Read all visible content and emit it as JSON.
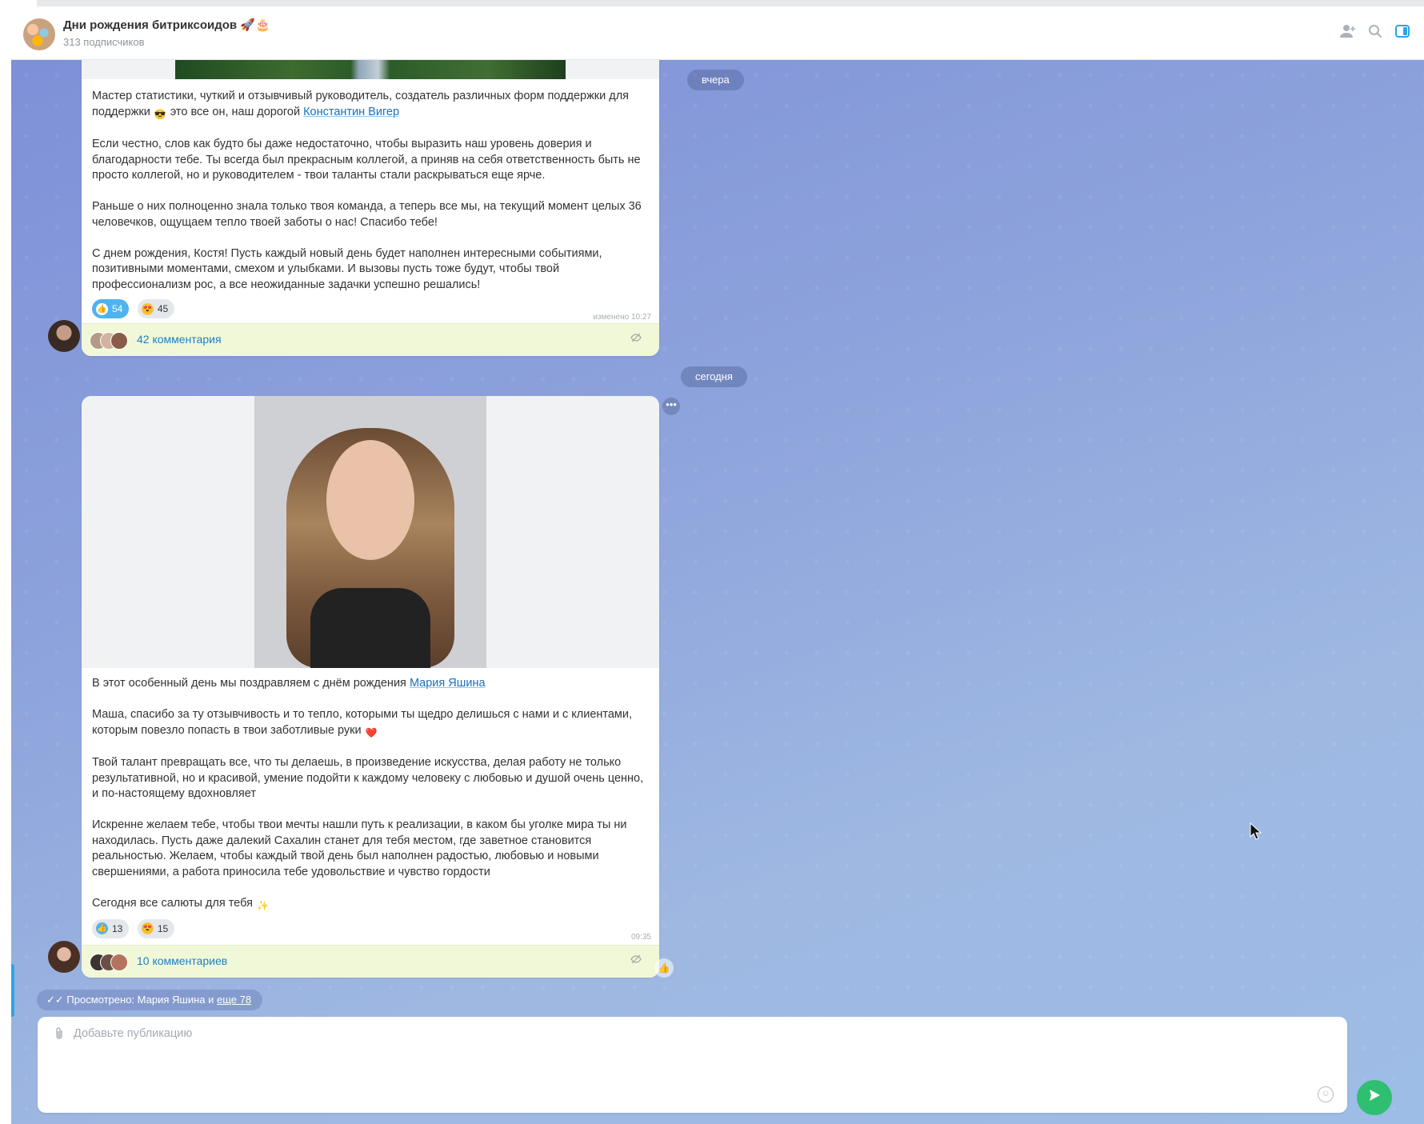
{
  "header": {
    "title": "Дни рождения битриксоидов 🚀🎂",
    "subscribers": "313 подписчиков",
    "icons": [
      "add-user-icon",
      "search-icon",
      "sidebar-toggle-icon"
    ]
  },
  "date_yesterday": "вчера",
  "date_today": "сегодня",
  "post1": {
    "p1_text": "Мастер статистики, чуткий и отзывчивый руководитель, создатель различных форм поддержки для поддержки ",
    "p1_emoji": "😎",
    "p1_after": " это все он, наш дорогой ",
    "p1_link": "Константин Вигер",
    "p2": "Если честно, слов как будто бы даже недостаточно, чтобы выразить наш уровень доверия и благодарности тебе. Ты всегда был прекрасным коллегой, а приняв на себя ответственность быть не просто коллегой, но и руководителем - твои таланты стали раскрываться еще ярче.",
    "p3": "Раньше о них полноценно знала только твоя команда, а теперь все мы, на текущий момент целых 36 человечков, ощущаем тепло твоей заботы о нас! Спасибо тебе!",
    "p4": "С днем рождения, Костя! Пусть каждый новый день будет наполнен интересными событиями, позитивными моментами, смехом и улыбками. И вызовы пусть тоже будут, чтобы твой профессионализм рос, а все неожиданные задачки успешно решались!",
    "like_count": "54",
    "face_count": "45",
    "timestamp": "изменено 10:27",
    "comments": "42 комментария"
  },
  "post2": {
    "p1_text": "В этот особенный день мы поздравляем с днём рождения ",
    "p1_link": "Мария Яшина",
    "p2_text": "Маша, спасибо за ту отзывчивость и то тепло, которыми ты щедро делишься с нами и с клиентами, которым повезло попасть в твои заботливые руки ",
    "p2_emoji": "❤️",
    "p3": "Твой талант превращать все, что ты делаешь, в произведение искусства, делая работу не только результативной, но и красивой, умение подойти к каждому человеку с любовью и душой очень ценно, и по-настоящему вдохновляет",
    "p4": "Искренне желаем тебе, чтобы твои мечты нашли путь к реализации, в каком бы уголке мира ты ни находилась. Пусть даже далекий Сахалин станет для тебя местом, где заветное становится реальностью. Желаем, чтобы каждый твой день был наполнен радостью, любовью и новыми свершениями, а работа приносила тебе удовольствие и чувство гордости",
    "p5_text": "Сегодня все салюты для тебя ",
    "p5_emoji": "✨",
    "like_count": "13",
    "face_count": "15",
    "timestamp": "09:35",
    "comments": "10 комментариев"
  },
  "seen": {
    "prefix": "Просмотрено: Мария Яшина и ",
    "more": "еще 78"
  },
  "composer": {
    "placeholder": "Добавьте публикацию"
  },
  "colors": {
    "accent_link": "#1b6fb5",
    "like_badge": "#4fb3f0",
    "comments_bg": "#f1f8d8",
    "send_button": "#2fbf71"
  }
}
